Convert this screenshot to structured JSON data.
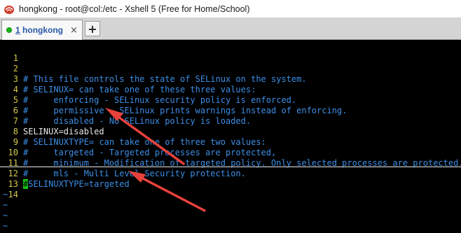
{
  "window": {
    "title": "hongkong - root@col:/etc - Xshell 5 (Free for Home/School)"
  },
  "tabs": [
    {
      "number": "1",
      "label": "hongkong",
      "close_glyph": "×"
    }
  ],
  "add_tab_label": "+",
  "terminal": {
    "lines": [
      {
        "no": "1",
        "text": ""
      },
      {
        "no": "2",
        "text": "# This file controls the state of SELinux on the system."
      },
      {
        "no": "3",
        "text": "# SELINUX= can take one of these three values:"
      },
      {
        "no": "4",
        "text": "#     enforcing - SELinux security policy is enforced."
      },
      {
        "no": "5",
        "text": "#     permissive - SELinux prints warnings instead of enforcing."
      },
      {
        "no": "6",
        "text": "#     disabled - No SELinux policy is loaded."
      },
      {
        "no": "7",
        "text": "SELINUX=disabled"
      },
      {
        "no": "8",
        "text": "# SELINUXTYPE= can take one of three two values:"
      },
      {
        "no": "9",
        "text": "#     targeted - Targeted processes are protected,"
      },
      {
        "no": "10",
        "text": "#     minimum - Modification of targeted policy. Only selected processes are protected."
      },
      {
        "no": "11",
        "text": "#     mls - Multi Level Security protection."
      },
      {
        "no": "12",
        "cursor_char": "#",
        "text": "SELINUXTYPE=targeted"
      },
      {
        "no": "13",
        "text": ""
      },
      {
        "no": "14",
        "text": ""
      }
    ],
    "tilde": "~"
  },
  "colors": {
    "comment": "#3c8ee6",
    "line_number": "#d6c84b",
    "plain_text": "#e8e8e8",
    "cursor": "#14c814",
    "annotation_arrow": "#e8413c",
    "tab_indicator": "#16b816"
  },
  "icons": {
    "app": "xshell-app-icon",
    "tab_status": "connected-dot-icon",
    "tab_close": "close-icon",
    "add_tab": "plus-icon"
  }
}
